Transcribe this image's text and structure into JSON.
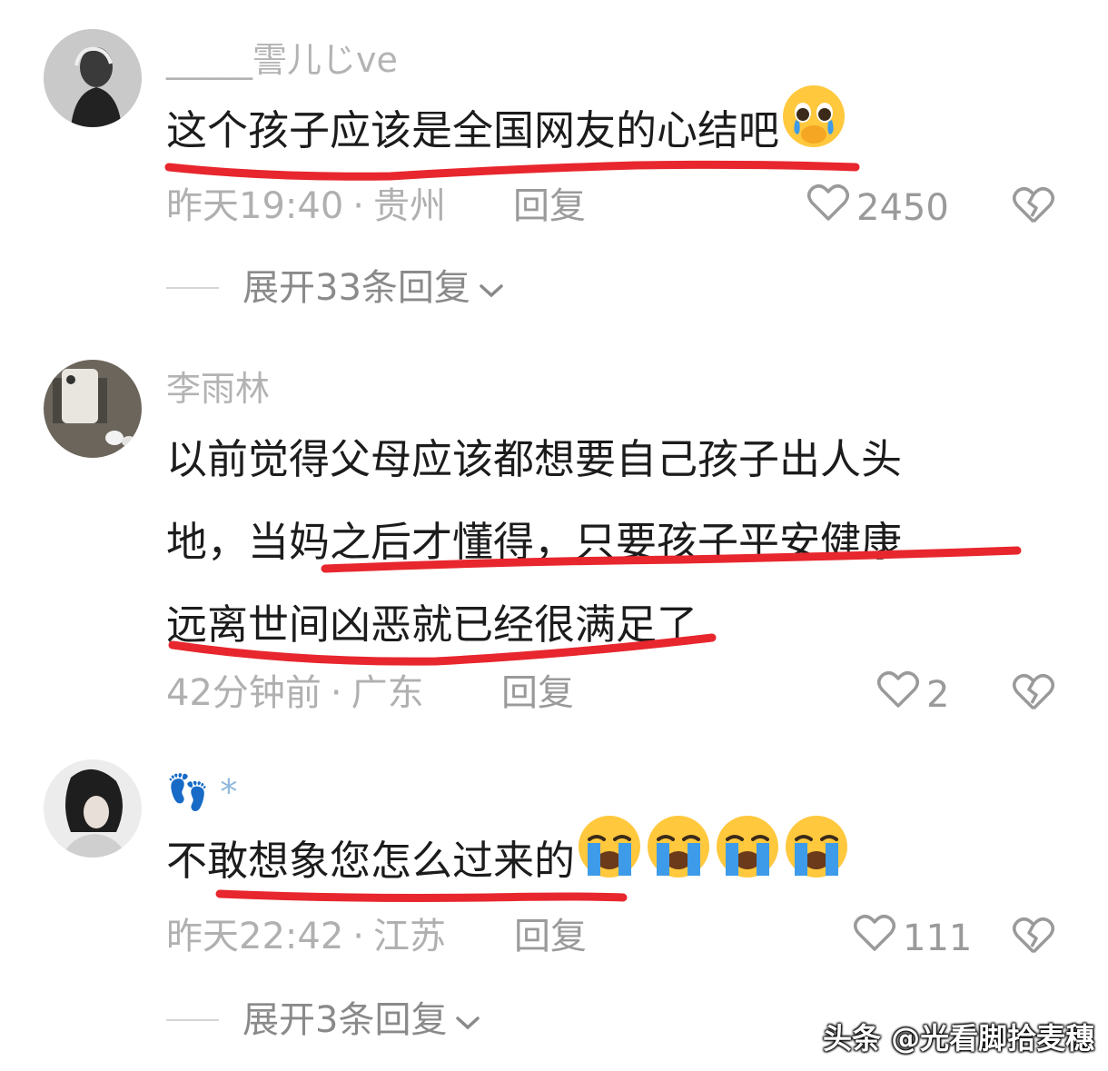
{
  "comments": [
    {
      "username": "_____霅儿じve",
      "text_lines": [
        "这个孩子应该是全国网友的心结吧"
      ],
      "emoji": "pleading-face",
      "time": "昨天19:40",
      "location": "贵州",
      "reply_label": "回复",
      "likes": "2450",
      "expand_replies": "展开33条回复"
    },
    {
      "username": "李雨林",
      "text_lines": [
        "以前觉得父母应该都想要自己孩子出人头",
        "地，当妈之后才懂得，只要孩子平安健康",
        "远离世间凶恶就已经很满足了"
      ],
      "time": "42分钟前",
      "location": "广东",
      "reply_label": "回复",
      "likes": "2"
    },
    {
      "username": "👣 *",
      "text_lines": [
        "不敢想象您怎么过来的"
      ],
      "emoji": "loudly-crying-face",
      "emoji_count": 4,
      "time": "昨天22:42",
      "location": "江苏",
      "reply_label": "回复",
      "likes": "111",
      "expand_replies": "展开3条回复"
    }
  ],
  "separator": "·",
  "watermark": "头条 @光看脚拾麦穗",
  "colors": {
    "underline": "#e8262d",
    "meta": "#b0b0b0",
    "emoji_yellow": "#ffc83d",
    "tear_blue": "#3d9be9"
  }
}
